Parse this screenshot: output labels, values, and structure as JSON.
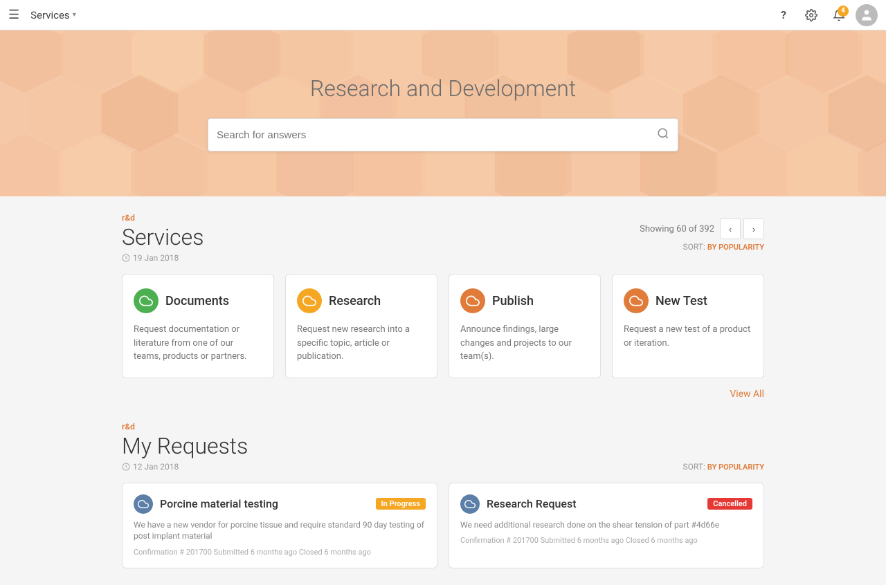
{
  "topbar": {
    "hamburger_label": "☰",
    "brand_label": "Services",
    "brand_chevron": "▾",
    "help_icon": "?",
    "gear_icon": "⚙",
    "notif_count": "4",
    "avatar_icon": "👤"
  },
  "hero": {
    "title": "Research and Development",
    "search_placeholder": "Search for answers"
  },
  "services_section": {
    "label": "r&d",
    "title": "Services",
    "date": "19 Jan 2018",
    "showing": "Showing 60 of 392",
    "sort_label": "SORT:",
    "sort_value": "BY POPULARITY",
    "view_all": "View All",
    "cards": [
      {
        "icon": "☁",
        "icon_color": "green",
        "title": "Documents",
        "description": "Request documentation or literature from one of our teams, products or partners."
      },
      {
        "icon": "☁",
        "icon_color": "yellow",
        "title": "Research",
        "description": "Request new research into a specific topic, article or publication."
      },
      {
        "icon": "☁",
        "icon_color": "orange",
        "title": "Publish",
        "description": "Announce findings, large changes and projects to our team(s)."
      },
      {
        "icon": "☁",
        "icon_color": "orange",
        "title": "New Test",
        "description": "Request a new test of a product or iteration."
      }
    ]
  },
  "requests_section": {
    "label": "r&d",
    "title": "My Requests",
    "date": "12 Jan 2018",
    "sort_label": "SORT:",
    "sort_value": "BY POPULARITY",
    "requests": [
      {
        "icon": "☁",
        "title": "Porcine material testing",
        "badge": "In Progress",
        "badge_type": "inprogress",
        "description": "We have a new vendor for porcine tissue and require standard 90 day testing of post implant material",
        "meta": "Confirmation # 201700  Submitted 6 months ago  Closed     6 months ago"
      },
      {
        "icon": "☁",
        "title": "Research Request",
        "badge": "Cancelled",
        "badge_type": "cancelled",
        "description": "We need additional research done on the shear tension of part #4d66e",
        "meta": "Confirmation # 201700  Submitted 6 months ago  Closed     6 months ago"
      }
    ]
  }
}
